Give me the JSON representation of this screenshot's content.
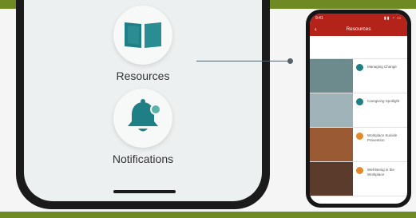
{
  "colors": {
    "band": "#6f8a22",
    "accent": "#1f7f86",
    "header_red": "#b3231a",
    "icon_orange": "#e08a2a"
  },
  "main_menu": {
    "items": [
      {
        "label": "Resources",
        "icon": "book-icon"
      },
      {
        "label": "Notifications",
        "icon": "bell-icon"
      }
    ]
  },
  "resources_screen": {
    "status": {
      "time": "9:41",
      "icons": "▮▮ ◔ ▭"
    },
    "header": {
      "title": "Resources",
      "back_icon": "chevron-left-icon"
    },
    "rows": [
      {
        "thumb": "#ffffff",
        "icon_color": "#ffffff",
        "title": "",
        "text": ""
      },
      {
        "thumb": "#6d8a8c",
        "icon_color": "#1f7f86",
        "title": "Managing Change",
        "text": ""
      },
      {
        "thumb": "#9fb3b8",
        "icon_color": "#1f7f86",
        "title": "Caregiving Spotlight",
        "text": ""
      },
      {
        "thumb": "#9a5a34",
        "icon_color": "#e08a2a",
        "title": "Workplace Suicide Prevention",
        "text": ""
      },
      {
        "thumb": "#5a3b2c",
        "icon_color": "#e08a2a",
        "title": "Well-Being in the Workplace",
        "text": ""
      }
    ]
  }
}
